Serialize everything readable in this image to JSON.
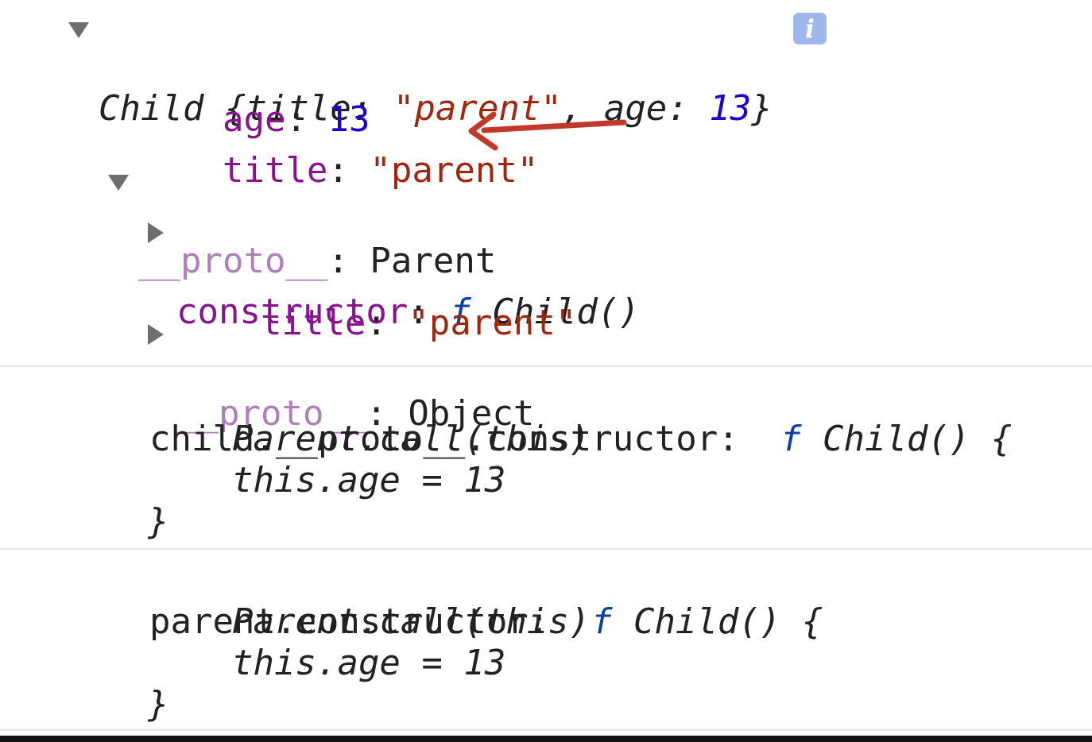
{
  "tree": {
    "root": {
      "class_name": "Child",
      "open_brace": "{",
      "k1": "title",
      "v1": "\"parent\"",
      "comma": ",",
      "k2": "age",
      "v2": "13",
      "close_brace": "}",
      "colon": ":"
    },
    "age_row": {
      "key": "age",
      "colon": ":",
      "value": "13"
    },
    "title_row": {
      "key": "title",
      "colon": ":",
      "value": "\"parent\""
    },
    "proto_row": {
      "key": "__proto__",
      "colon": ":",
      "value": "Parent"
    },
    "constructor_row": {
      "key": "constructor",
      "colon": ":",
      "f": "f",
      "value": "Child()"
    },
    "title2_row": {
      "key": "title",
      "colon": ":",
      "value": "\"parent\""
    },
    "proto2_row": {
      "key": "__proto__",
      "colon": ":",
      "value": "Object"
    },
    "info_icon": "i"
  },
  "log1": {
    "label": "child.__proto__.constructor:",
    "f": "f",
    "sig": "Child() {",
    "body1": "Parent.call(this)",
    "body2": "this.age = 13",
    "close": "}"
  },
  "log2": {
    "label": "parent.constructor:",
    "f": "f",
    "sig": "Child() {",
    "body1": "Parent.call(this)",
    "body2": "this.age = 13",
    "close": "}"
  },
  "colors": {
    "key": "#881391",
    "string": "#a1260d",
    "number": "#1c00cf",
    "arrow": "#c0392b",
    "info_icon_bg": "#9fb7ea"
  },
  "icons": [
    "expand-triangle-icon",
    "collapse-triangle-icon",
    "info-icon",
    "annotation-arrow-icon"
  ]
}
